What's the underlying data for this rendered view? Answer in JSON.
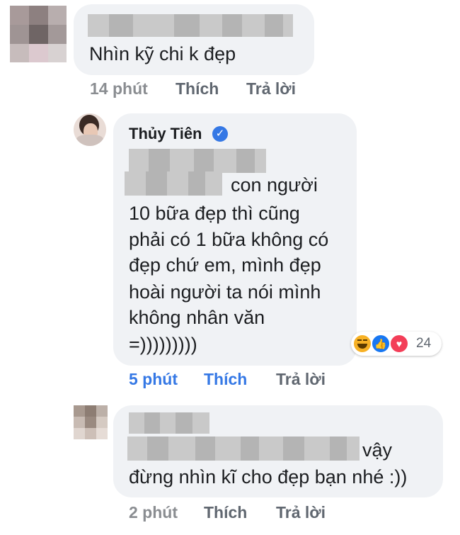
{
  "comment1": {
    "text": "Nhìn kỹ chi k đẹp",
    "time": "14 phút",
    "like": "Thích",
    "reply": "Trả lời"
  },
  "comment2": {
    "author": "Thủy Tiên",
    "lines": [
      "con người",
      "10 bữa đẹp thì cũng",
      "phải có 1 bữa không có",
      "đẹp chứ em, mình đẹp",
      "hoài người ta nói mình",
      "không nhân văn",
      "=)))))))))"
    ],
    "reaction_count": "24",
    "reactions": [
      "haha-icon",
      "like-icon",
      "love-icon"
    ],
    "time": "5 phút",
    "like": "Thích",
    "reply": "Trả lời"
  },
  "comment3": {
    "lines": [
      "vậy",
      "đừng nhìn kĩ cho đẹp bạn nhé :))"
    ],
    "time": "2 phút",
    "like": "Thích",
    "reply": "Trả lời"
  },
  "colors": {
    "bubble": "#f0f2f5",
    "link_blue": "#3578e5",
    "meta_gray": "#8a8d91"
  }
}
